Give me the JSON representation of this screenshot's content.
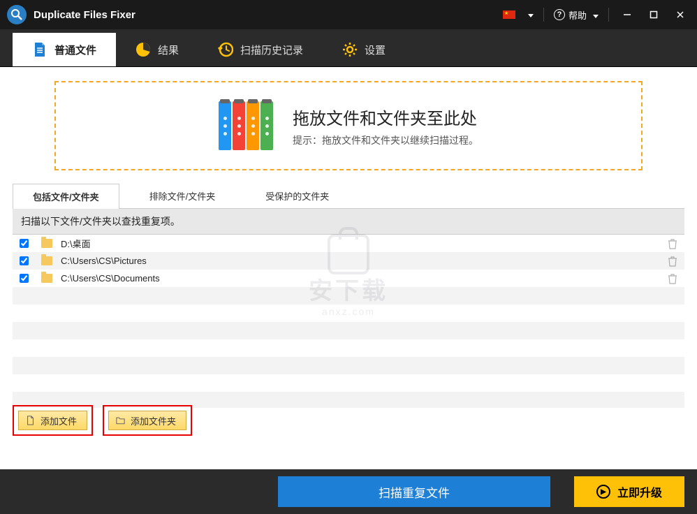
{
  "titlebar": {
    "title": "Duplicate Files Fixer",
    "help": "帮助"
  },
  "tabs": [
    {
      "label": "普通文件",
      "icon": "file"
    },
    {
      "label": "结果",
      "icon": "pie"
    },
    {
      "label": "扫描历史记录",
      "icon": "history"
    },
    {
      "label": "设置",
      "icon": "gear"
    }
  ],
  "dropzone": {
    "title": "拖放文件和文件夹至此处",
    "hint": "提示：拖放文件和文件夹以继续扫描过程。"
  },
  "subtabs": [
    {
      "label": "包括文件/文件夹"
    },
    {
      "label": "排除文件/文件夹"
    },
    {
      "label": "受保护的文件夹"
    }
  ],
  "instruction": "扫描以下文件/文件夹以查找重复项。",
  "files": [
    {
      "path": "D:\\桌面",
      "checked": true
    },
    {
      "path": "C:\\Users\\CS\\Pictures",
      "checked": true
    },
    {
      "path": "C:\\Users\\CS\\Documents",
      "checked": true
    }
  ],
  "buttons": {
    "add_file": "添加文件",
    "add_folder": "添加文件夹",
    "scan": "扫描重复文件",
    "upgrade": "立即升级"
  },
  "watermark": {
    "txt": "安下载",
    "sub": "anxz.com"
  }
}
